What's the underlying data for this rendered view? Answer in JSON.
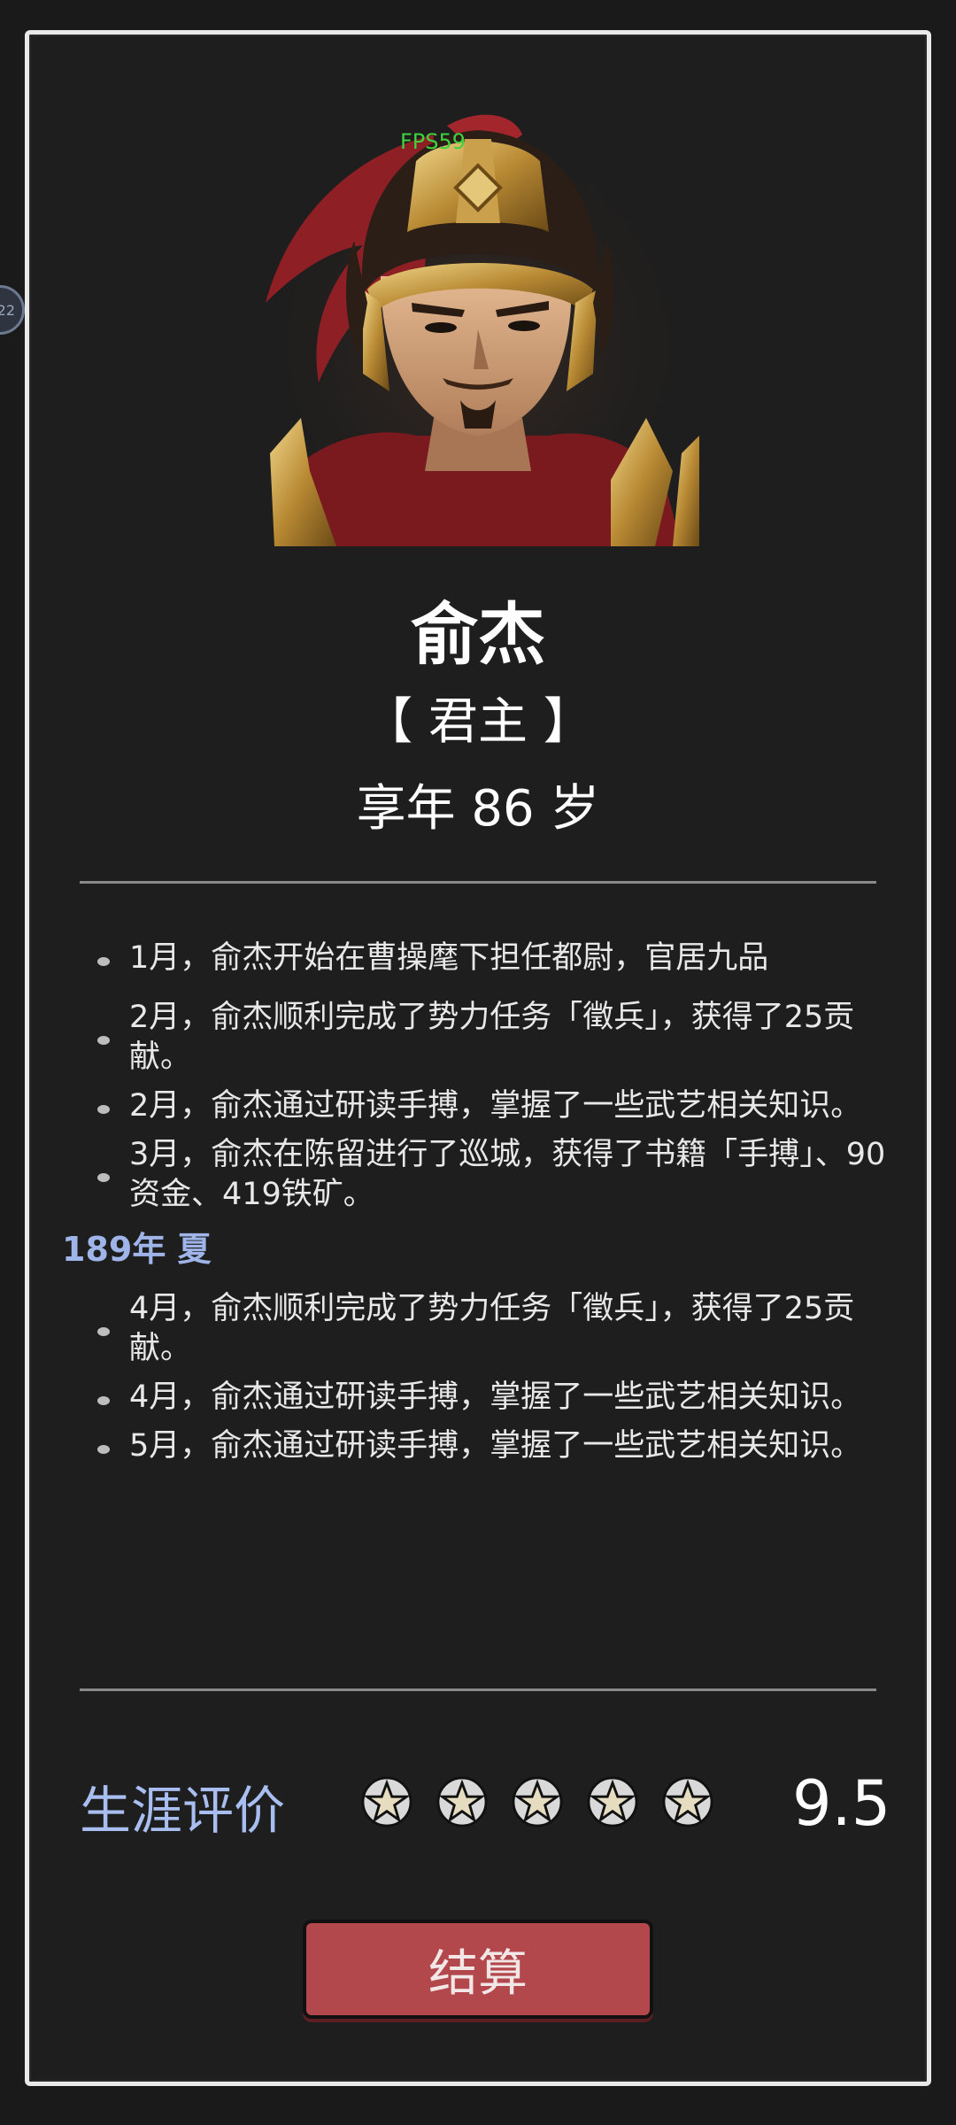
{
  "overlay": {
    "fps": "FPS59",
    "side_bubble": "22"
  },
  "character": {
    "name": "俞杰",
    "title": "【 君主 】",
    "age": "享年 86 岁"
  },
  "log": {
    "items_a": [
      "1月，俞杰开始在曹操麾下担任都尉，官居九品",
      "2月，俞杰顺利完成了势力任务「徵兵」，获得了25贡献。",
      "2月，俞杰通过研读手搏，掌握了一些武艺相关知识。",
      "3月，俞杰在陈留进行了巡城，获得了书籍「手搏」、90资金、419铁矿。"
    ],
    "season": "189年 夏",
    "items_b": [
      "4月，俞杰顺利完成了势力任务「徵兵」，获得了25贡献。",
      "4月，俞杰通过研读手搏，掌握了一些武艺相关知识。",
      "5月，俞杰通过研读手搏，掌握了一些武艺相关知识。"
    ]
  },
  "rating": {
    "label": "生涯评价",
    "stars": 5,
    "score": "9.5"
  },
  "button": {
    "settle": "结算"
  },
  "colors": {
    "background": "#1e1e1e",
    "accent_blue": "#a8bdf0",
    "button_red": "#b2474c"
  }
}
